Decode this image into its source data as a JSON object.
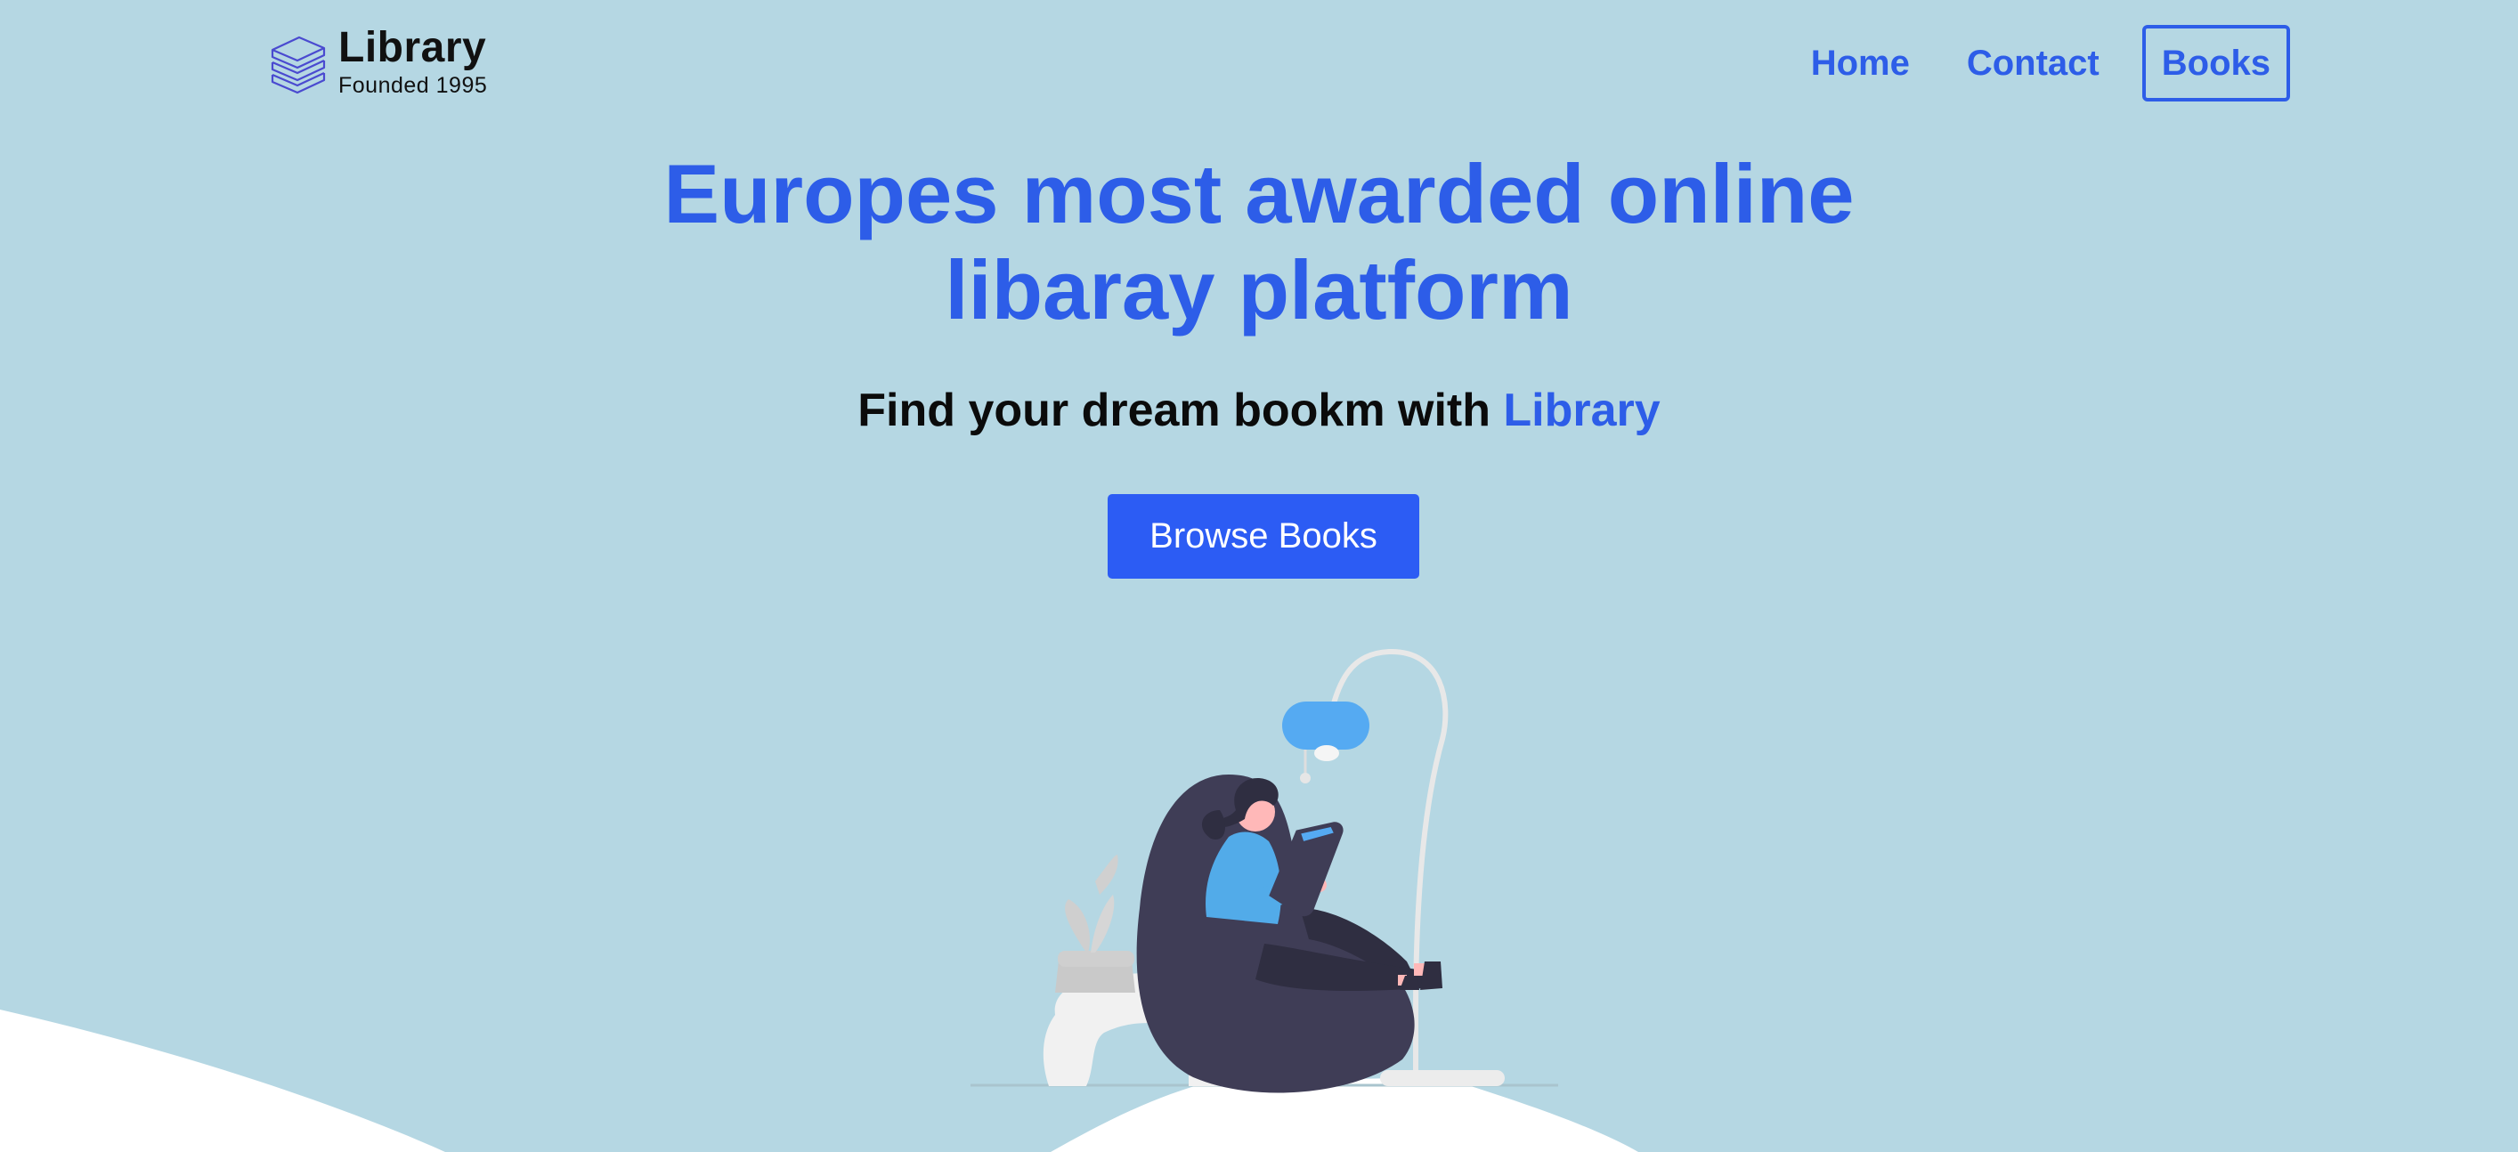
{
  "colors": {
    "background": "#b5d7e3",
    "accent": "#2d5de8",
    "button": "#2c5cf4",
    "text": "#0b0b0b"
  },
  "brand": {
    "title": "Library",
    "subtitle": "Founded 1995",
    "icon": "stacked-books-icon"
  },
  "nav": [
    {
      "label": "Home"
    },
    {
      "label": "Contact"
    },
    {
      "label": "Books"
    }
  ],
  "hero": {
    "title_line1": "Europes most awarded online",
    "title_line2": "libaray platform",
    "subtitle_prefix": "Find your dream bookm with ",
    "subtitle_accent": "Library",
    "cta_label": "Browse Books"
  },
  "illustration": {
    "name": "woman-reading-on-beanbag-illustration"
  }
}
